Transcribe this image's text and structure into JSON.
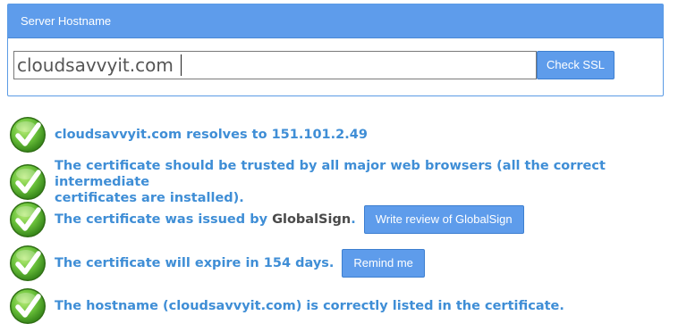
{
  "form": {
    "header": "Server Hostname",
    "hostname_value": "cloudsavvyit.com",
    "check_button": "Check SSL"
  },
  "results": {
    "resolve": "cloudsavvyit.com resolves to 151.101.2.49",
    "trust_line1": "The certificate should be trusted by all major web browsers (all the correct intermediate",
    "trust_line2": "certificates are installed).",
    "issued_prefix": "The certificate was issued by",
    "issuer": "GlobalSign",
    "issued_suffix": ".",
    "review_button": "Write review of GlobalSign",
    "expiry": "The certificate will expire in 154 days.",
    "remind_button": "Remind me",
    "hostname_listed": "The hostname (cloudsavvyit.com) is correctly listed in the certificate."
  },
  "icons": {
    "status": "check-circle-icon"
  },
  "colors": {
    "accent": "#5e9ceb",
    "result_text": "#3f8ed6",
    "check_green": "#6cc33c"
  }
}
